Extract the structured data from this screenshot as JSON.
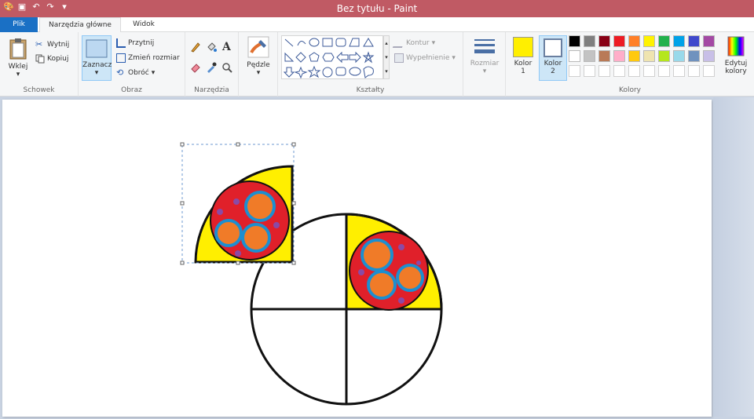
{
  "window": {
    "title": "Bez tytułu - Paint"
  },
  "tabs": {
    "file": "Plik",
    "home": "Narzędzia główne",
    "view": "Widok"
  },
  "clipboard": {
    "paste": "Wklej",
    "cut": "Wytnij",
    "copy": "Kopiuj",
    "label": "Schowek"
  },
  "image": {
    "select": "Zaznacz",
    "crop": "Przytnij",
    "resize": "Zmień rozmiar",
    "rotate": "Obróć",
    "label": "Obraz"
  },
  "tools": {
    "label": "Narzędzia"
  },
  "brushes": {
    "label": "Pędzle"
  },
  "shapes": {
    "outline": "Kontur",
    "fill": "Wypełnienie",
    "label": "Kształty"
  },
  "size": {
    "label": "Rozmiar"
  },
  "colors": {
    "color1_line1": "Kolor",
    "color1_line2": "1",
    "color2_line1": "Kolor",
    "color2_line2": "2",
    "edit_line1": "Edytuj",
    "edit_line2": "kolory",
    "label": "Kolory",
    "color1_value": "#ffef00",
    "color2_value": "#ffffff",
    "palette_row1": [
      "#000000",
      "#7f7f7f",
      "#880015",
      "#ed1c24",
      "#ff7f27",
      "#fff200",
      "#22b14c",
      "#00a2e8",
      "#3f48cc",
      "#a349a4"
    ],
    "palette_row2": [
      "#ffffff",
      "#c3c3c3",
      "#b97a57",
      "#ffaec9",
      "#ffc90e",
      "#efe4b0",
      "#b5e61d",
      "#99d9ea",
      "#7092be",
      "#c8bfe7"
    ]
  }
}
